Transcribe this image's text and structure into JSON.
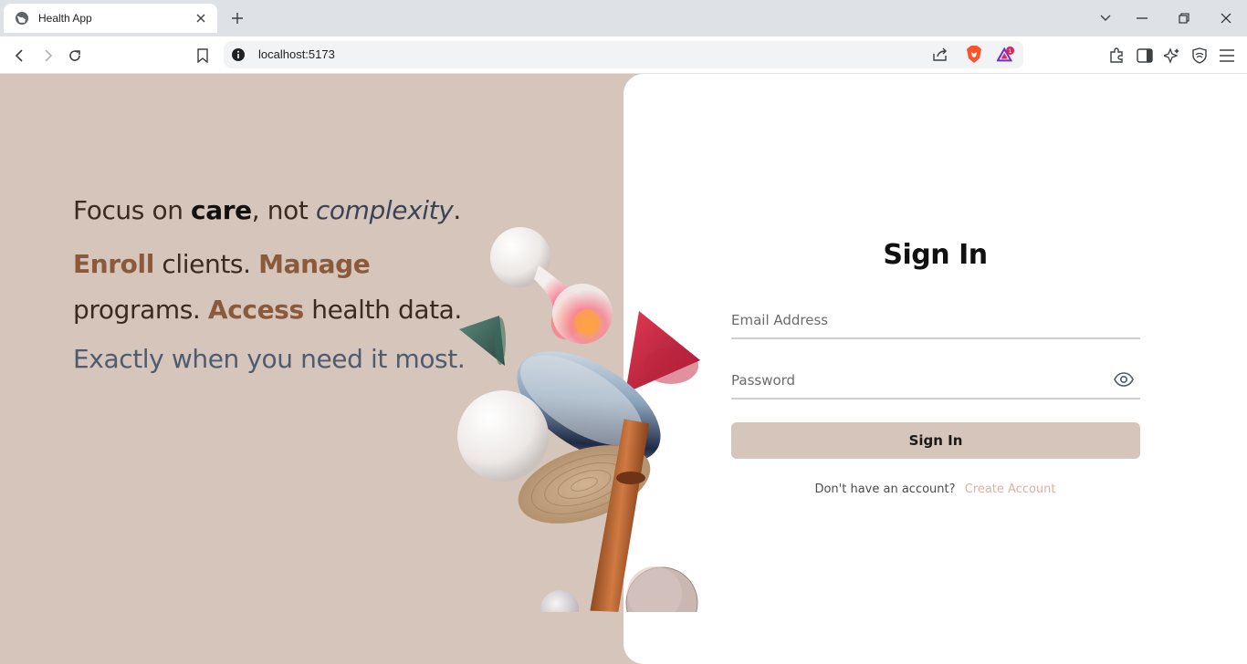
{
  "browser": {
    "tab_title": "Health App",
    "url": "localhost:5173",
    "extension_badge": "1"
  },
  "hero": {
    "line1_a": "Focus on ",
    "line1_bold": "care",
    "line1_b": ", not ",
    "line1_italic": "complexity",
    "line1_end": ".",
    "line2_w1": "Enroll",
    "line2_w2": " clients. ",
    "line2_w3": "Manage",
    "line2_w4": " programs. ",
    "line2_w5": "Access",
    "line2_w6": " health data.",
    "line3": "Exactly when you need it most."
  },
  "signin": {
    "title": "Sign In",
    "email_placeholder": "Email Address",
    "password_placeholder": "Password",
    "submit_label": "Sign In",
    "prompt": "Don't have an account?",
    "create_link": "Create Account"
  },
  "colors": {
    "page_bg": "#d5c5ba",
    "accent_brown": "#8a5a3b",
    "link": "#e0b0a0",
    "button_bg": "#d5c5ba"
  }
}
